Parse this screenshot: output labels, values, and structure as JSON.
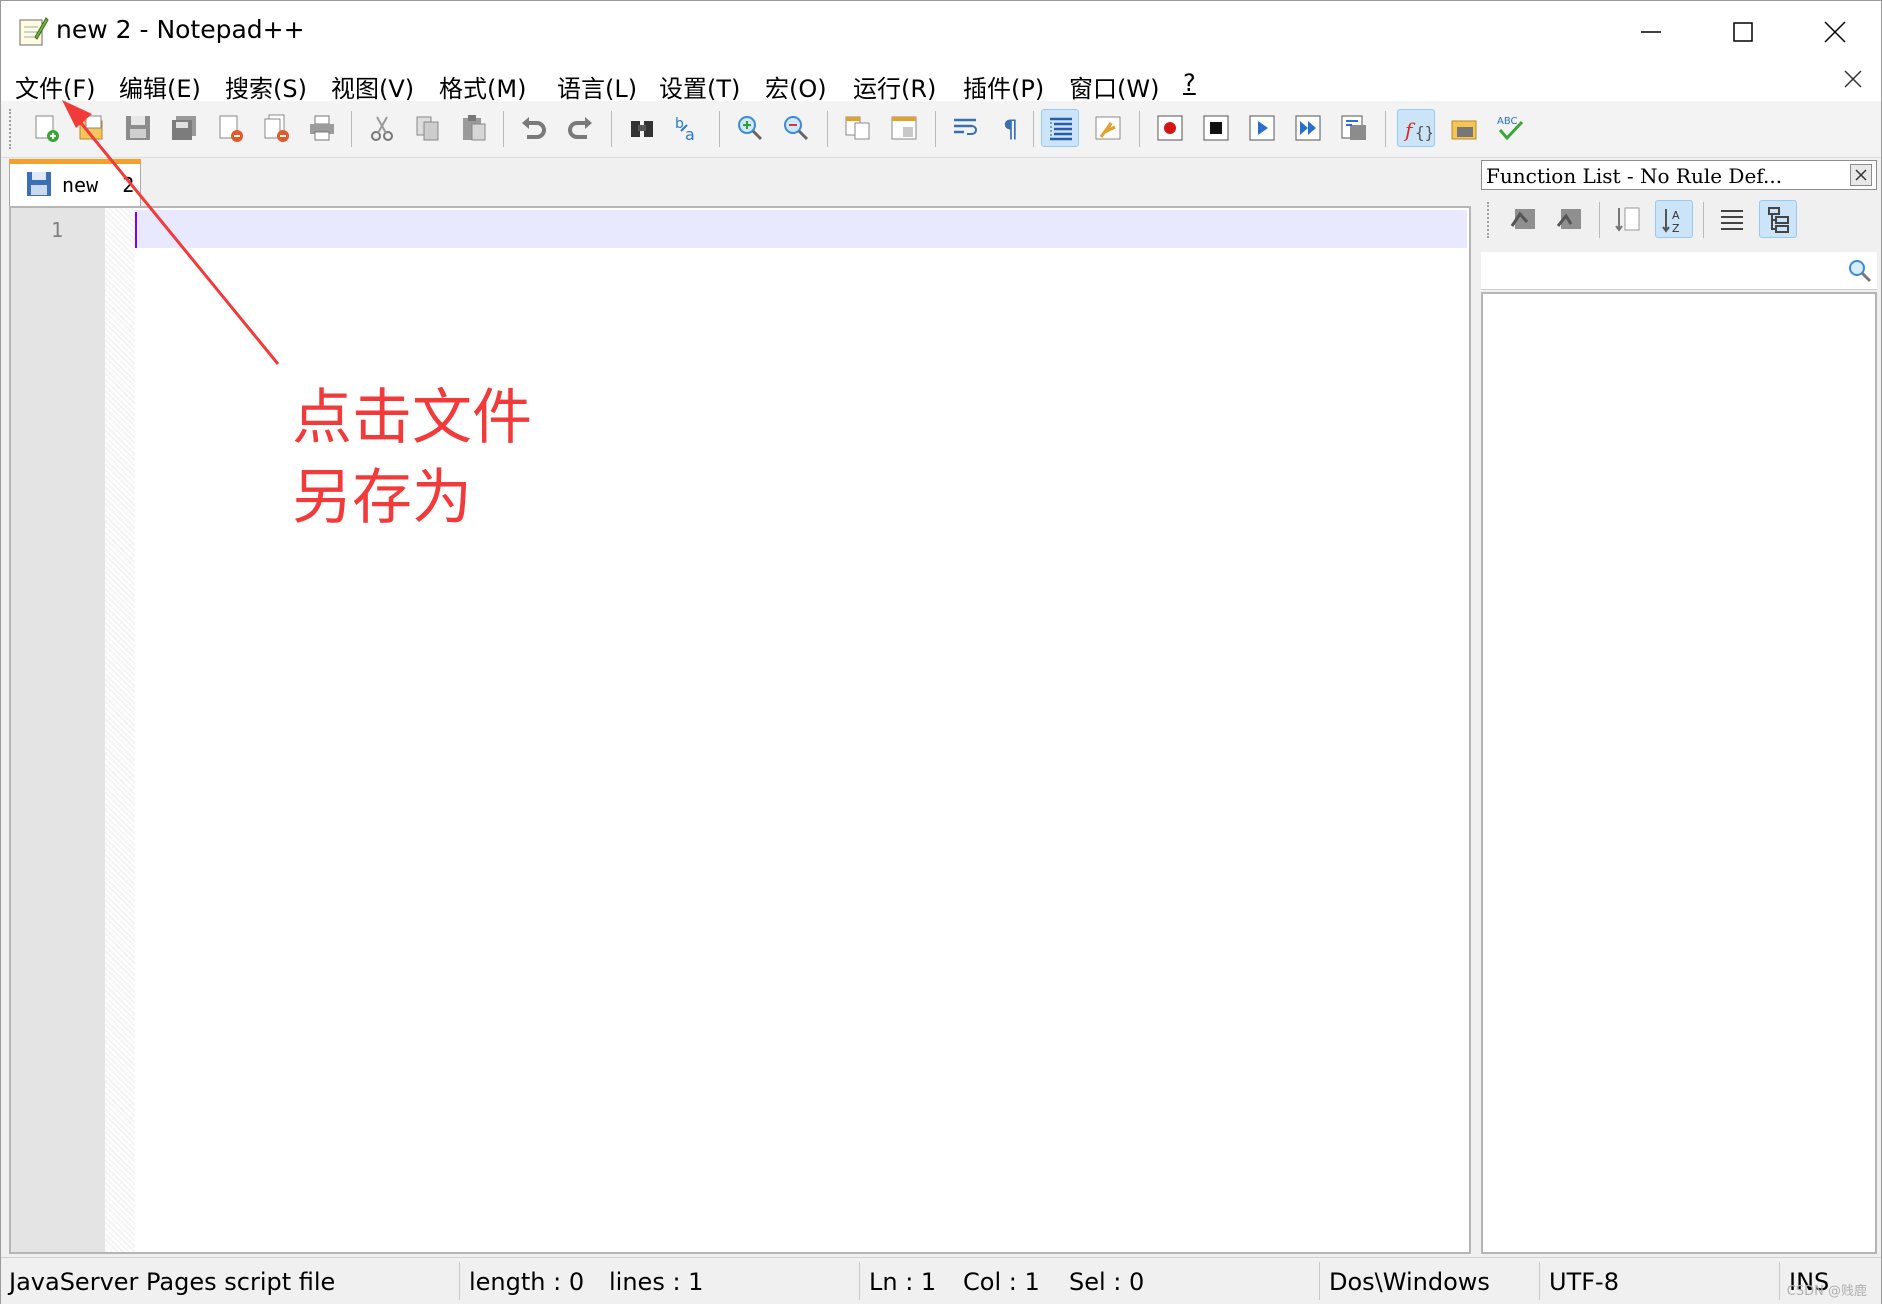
{
  "window": {
    "title": "new  2 - Notepad++"
  },
  "menu": {
    "items": [
      "文件(F)",
      "编辑(E)",
      "搜索(S)",
      "视图(V)",
      "格式(M)",
      "语言(L)",
      "设置(T)",
      "宏(O)",
      "运行(R)",
      "插件(P)",
      "窗口(W)",
      "?"
    ]
  },
  "toolbar": {
    "icons": [
      "new-file-icon",
      "open-file-icon",
      "save-icon",
      "save-all-icon",
      "close-icon",
      "close-all-icon",
      "print-icon",
      "cut-icon",
      "copy-icon",
      "paste-icon",
      "undo-icon",
      "redo-icon",
      "find-icon",
      "replace-icon",
      "zoom-in-icon",
      "zoom-out-icon",
      "sync-vertical-icon",
      "sync-horizontal-icon",
      "word-wrap-icon",
      "show-all-characters-icon",
      "indent-guide-icon",
      "doc-map-icon",
      "record-macro-icon",
      "stop-macro-icon",
      "play-macro-icon",
      "run-macro-multiple-icon",
      "save-macro-icon",
      "function-list-icon",
      "folder-as-workspace-icon",
      "spell-check-icon"
    ]
  },
  "tab": {
    "label": "new  2"
  },
  "editor": {
    "line_number": "1"
  },
  "function_list": {
    "title": "Function List - No Rule Def...",
    "search_value": ""
  },
  "status": {
    "file_type": "JavaServer Pages script file",
    "length": "length : 0",
    "lines": "lines : 1",
    "ln": "Ln : 1",
    "col": "Col : 1",
    "sel": "Sel : 0",
    "eol": "Dos\\Windows",
    "encoding": "UTF-8",
    "mode": "INS",
    "watermark": "CSDN @贱鹿"
  },
  "annotation": {
    "line1": "点击文件",
    "line2": "另存为",
    "color": "#f23a3a"
  }
}
